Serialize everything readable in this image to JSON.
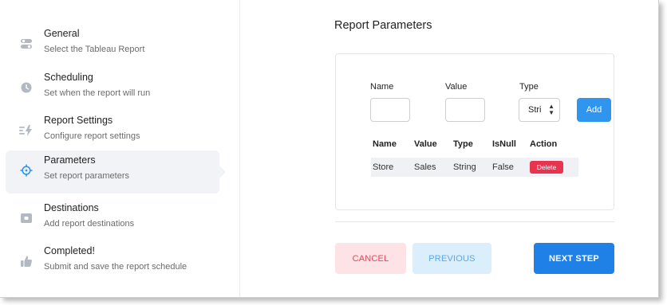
{
  "sidebar": {
    "steps": [
      {
        "title": "General",
        "subtitle": "Select the Tableau Report",
        "icon": "toggle-icon"
      },
      {
        "title": "Scheduling",
        "subtitle": "Set when the report will run",
        "icon": "clock-icon"
      },
      {
        "title": "Report Settings",
        "subtitle": "Configure report settings",
        "icon": "lightning-icon"
      },
      {
        "title": "Parameters",
        "subtitle": "Set report parameters",
        "icon": "crosshair-icon",
        "active": true
      },
      {
        "title": "Destinations",
        "subtitle": "Add report destinations",
        "icon": "inbox-icon"
      },
      {
        "title": "Completed!",
        "subtitle": "Submit and save the report schedule",
        "icon": "thumbs-up-icon"
      }
    ]
  },
  "main": {
    "title": "Report Parameters",
    "form": {
      "name_label": "Name",
      "value_label": "Value",
      "type_label": "Type",
      "name_value": "",
      "value_value": "",
      "type_selected": "Stri",
      "add_label": "Add"
    },
    "table": {
      "headers": [
        "Name",
        "Value",
        "Type",
        "IsNull",
        "Action"
      ],
      "rows": [
        {
          "name": "Store",
          "value": "Sales",
          "type": "String",
          "isnull": "False",
          "action": "Delete"
        }
      ]
    },
    "buttons": {
      "cancel": "CANCEL",
      "previous": "PREVIOUS",
      "next": "NEXT STEP"
    }
  },
  "colors": {
    "accent": "#1f80e6",
    "add": "#2f95ef",
    "delete": "#e8344e",
    "cancel_bg": "#fde3e6",
    "previous_bg": "#dbeefc",
    "active_step_bg": "#f2f3f7",
    "icon_gray": "#9aa0ac",
    "icon_active": "#2f95ef"
  }
}
